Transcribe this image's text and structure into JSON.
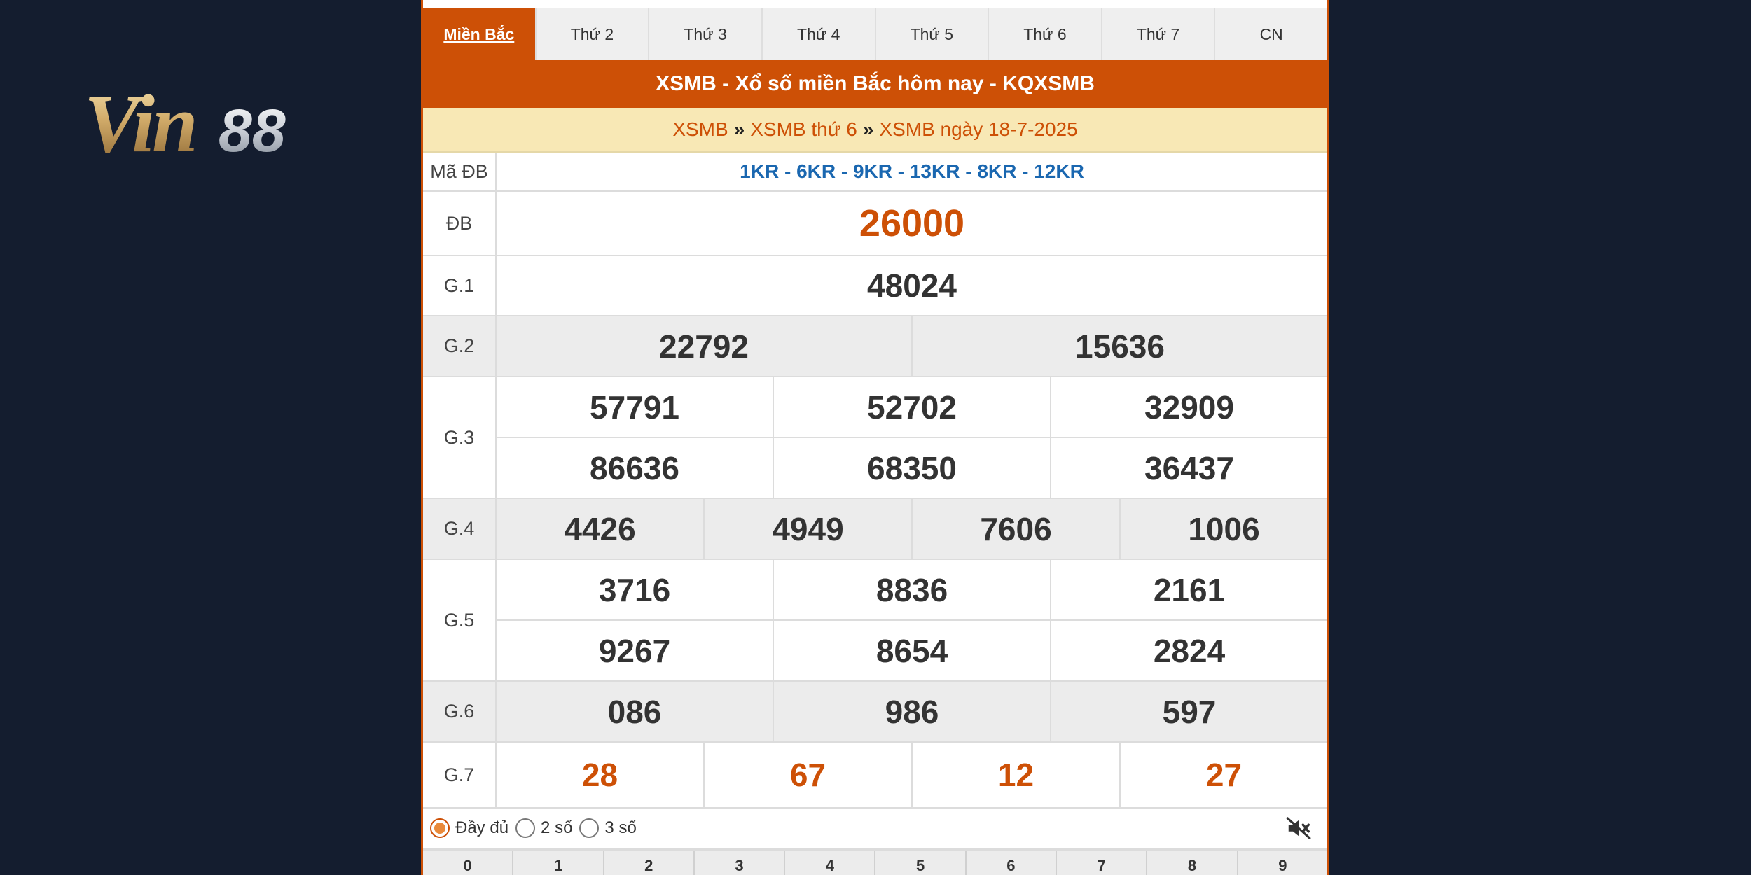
{
  "logo": {
    "text": "Vin88",
    "part1": "Vin",
    "part2": "88"
  },
  "tabs": [
    {
      "label": "Miền Bắc",
      "active": true
    },
    {
      "label": "Thứ 2"
    },
    {
      "label": "Thứ 3"
    },
    {
      "label": "Thứ 4"
    },
    {
      "label": "Thứ 5"
    },
    {
      "label": "Thứ 6"
    },
    {
      "label": "Thứ 7"
    },
    {
      "label": "CN"
    }
  ],
  "title": "XSMB - Xổ số miền Bắc hôm nay - KQXSMB",
  "breadcrumb": {
    "items": [
      "XSMB",
      "XSMB thứ 6",
      "XSMB ngày 18-7-2025"
    ],
    "separator": "»"
  },
  "results": {
    "ma_db": {
      "label": "Mã ĐB",
      "value": "1KR - 6KR - 9KR - 13KR - 8KR - 12KR"
    },
    "db": {
      "label": "ĐB",
      "value": "26000"
    },
    "g1": {
      "label": "G.1",
      "values": [
        "48024"
      ]
    },
    "g2": {
      "label": "G.2",
      "values": [
        "22792",
        "15636"
      ]
    },
    "g3": {
      "label": "G.3",
      "values": [
        "57791",
        "52702",
        "32909",
        "86636",
        "68350",
        "36437"
      ]
    },
    "g4": {
      "label": "G.4",
      "values": [
        "4426",
        "4949",
        "7606",
        "1006"
      ]
    },
    "g5": {
      "label": "G.5",
      "values": [
        "3716",
        "8836",
        "2161",
        "9267",
        "8654",
        "2824"
      ]
    },
    "g6": {
      "label": "G.6",
      "values": [
        "086",
        "986",
        "597"
      ]
    },
    "g7": {
      "label": "G.7",
      "values": [
        "28",
        "67",
        "12",
        "27"
      ]
    }
  },
  "options": {
    "items": [
      {
        "label": "Đầy đủ",
        "checked": true
      },
      {
        "label": "2 số"
      },
      {
        "label": "3 số"
      }
    ],
    "mute_icon": "speaker-muted-icon"
  },
  "digits": [
    "0",
    "1",
    "2",
    "3",
    "4",
    "5",
    "6",
    "7",
    "8",
    "9"
  ],
  "colors": {
    "background": "#141d2f",
    "accent": "#cd5006",
    "breadcrumb_bg": "#f8e8b5",
    "code_blue": "#1a67b0"
  }
}
